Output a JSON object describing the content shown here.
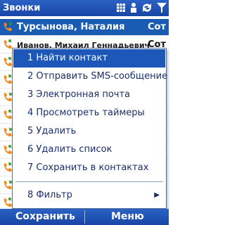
{
  "window": {
    "title": "Звонки"
  },
  "status_icons": [
    "phone-grid-icon",
    "person-icon",
    "sync-icon",
    "signal-icon"
  ],
  "call_list": {
    "rows": [
      {
        "name": "Турсынова, Наталия",
        "time": "Сот",
        "selected": true
      },
      {
        "name": "Иванов, Михаил Геннадьевич",
        "time": "Сот",
        "selected": false
      }
    ]
  },
  "menu": {
    "items": [
      {
        "label": "1 Найти контакт",
        "active": true
      },
      {
        "label": "2 Отправить SMS-сообщение",
        "active": false
      },
      {
        "label": "3 Электронная почта",
        "active": false
      },
      {
        "label": "4 Просмотреть таймеры",
        "active": false
      },
      {
        "label": "5 Удалить",
        "active": false
      },
      {
        "label": "6 Удалить список",
        "active": false
      },
      {
        "label": "7 Сохранить в контактах",
        "active": false
      },
      {
        "label": "8 Фильтр",
        "active": false,
        "submenu": true
      }
    ]
  },
  "softkeys": {
    "left": "Сохранить",
    "right": "Меню"
  },
  "colors": {
    "bar": "#1d57b8",
    "menu_text": "#1a2e6b",
    "phone_orange": "#f08a1c",
    "phone_green": "#2e9a2e"
  }
}
